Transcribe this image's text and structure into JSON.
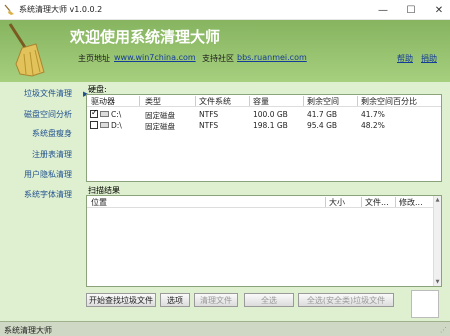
{
  "window": {
    "title": "系统清理大师 v1.0.0.2",
    "tooltip": "关闭"
  },
  "header": {
    "welcome": "欢迎使用系统清理大师",
    "homepage_label": "主页地址",
    "homepage_url": "www.win7china.com",
    "support_label": "支持社区",
    "support_url": "bbs.ruanmei.com",
    "help": "帮助",
    "donate": "捐助"
  },
  "sidebar": {
    "items": [
      {
        "label": "垃圾文件清理"
      },
      {
        "label": "磁盘空间分析"
      },
      {
        "label": "系统盘瘦身"
      },
      {
        "label": "注册表清理"
      },
      {
        "label": "用户隐私清理"
      },
      {
        "label": "系统字体清理"
      }
    ]
  },
  "disk": {
    "label": "硬盘:",
    "columns": [
      "驱动器",
      "类型",
      "文件系统",
      "容量",
      "剩余空间",
      "剩余空间百分比"
    ],
    "rows": [
      {
        "checked": true,
        "drive": "C:\\",
        "type": "固定磁盘",
        "fs": "NTFS",
        "capacity": "100.0 GB",
        "free": "41.7 GB",
        "percent": "41.7%"
      },
      {
        "checked": false,
        "drive": "D:\\",
        "type": "固定磁盘",
        "fs": "NTFS",
        "capacity": "198.1 GB",
        "free": "95.4 GB",
        "percent": "48.2%"
      }
    ]
  },
  "scan": {
    "label": "扫描结果",
    "columns": [
      "位置",
      "大小",
      "文件...",
      "修改..."
    ]
  },
  "buttons": {
    "start": "开始查找垃圾文件",
    "options": "选项",
    "clean": "清理文件",
    "select_all": "全选",
    "select_all_safe": "全选(安全类)垃圾文件"
  },
  "status": {
    "text": "系统清理大师"
  },
  "colors": {
    "header_green": "#86b45f",
    "body_green": "#dff0d0",
    "link_blue": "#143c9b"
  }
}
